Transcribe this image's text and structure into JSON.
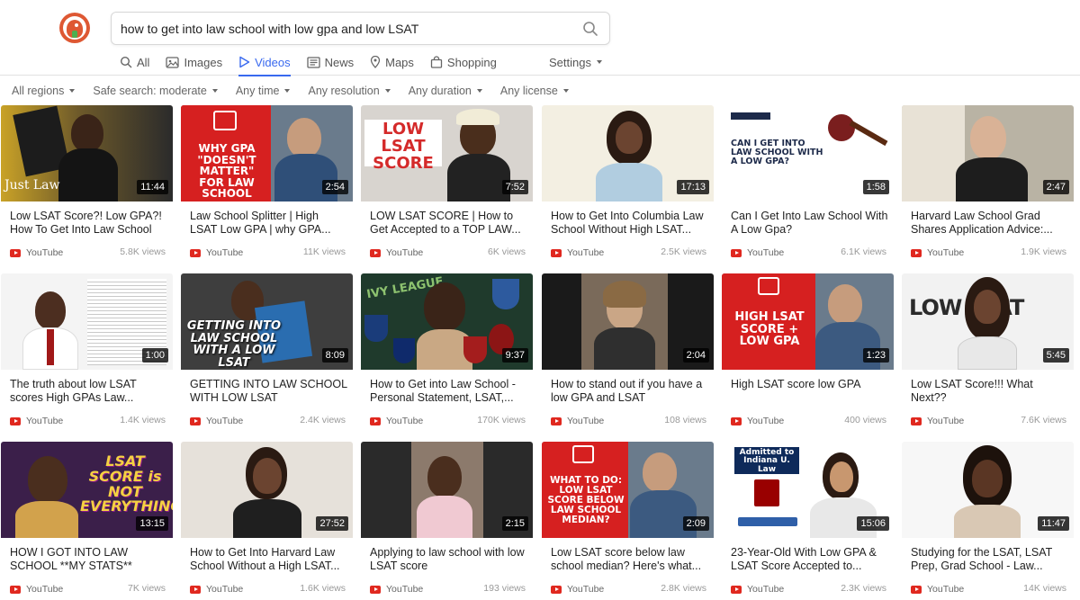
{
  "search": {
    "query": "how to get into law school with low gpa and low LSAT"
  },
  "tabs": [
    {
      "label": "All",
      "icon": "search-icon",
      "active": false
    },
    {
      "label": "Images",
      "icon": "image-icon",
      "active": false
    },
    {
      "label": "Videos",
      "icon": "play-icon",
      "active": true
    },
    {
      "label": "News",
      "icon": "news-icon",
      "active": false
    },
    {
      "label": "Maps",
      "icon": "map-pin-icon",
      "active": false
    },
    {
      "label": "Shopping",
      "icon": "shopping-bag-icon",
      "active": false
    }
  ],
  "settings_label": "Settings",
  "filters": [
    {
      "label": "All regions"
    },
    {
      "label": "Safe search: moderate"
    },
    {
      "label": "Any time"
    },
    {
      "label": "Any resolution"
    },
    {
      "label": "Any duration"
    },
    {
      "label": "Any license"
    }
  ],
  "source_label": "YouTube",
  "videos": [
    {
      "title": "Low LSAT Score?! Low GPA?! How To Get Into Law School",
      "duration": "11:44",
      "views": "5.8K views",
      "thumb_text": "Just Law"
    },
    {
      "title": "Law School Splitter | High LSAT Low GPA | why GPA...",
      "duration": "2:54",
      "views": "11K views",
      "thumb_text": "WHY GPA \"DOESN'T MATTER\" FOR LAW SCHOOL"
    },
    {
      "title": "LOW LSAT SCORE | How to Get Accepted to a TOP LAW...",
      "duration": "7:52",
      "views": "6K views",
      "thumb_text": "LOW LSAT SCORE"
    },
    {
      "title": "How to Get Into Columbia Law School Without High LSAT...",
      "duration": "17:13",
      "views": "2.5K views",
      "thumb_text": ""
    },
    {
      "title": "Can I Get Into Law School With A Low Gpa?",
      "duration": "1:58",
      "views": "6.1K views",
      "thumb_text": "CAN I GET INTO LAW SCHOOL WITH A LOW GPA?"
    },
    {
      "title": "Harvard Law School Grad Shares Application Advice:...",
      "duration": "2:47",
      "views": "1.9K views",
      "thumb_text": ""
    },
    {
      "title": "The truth about low LSAT scores High GPAs Law...",
      "duration": "1:00",
      "views": "1.4K views",
      "thumb_text": ""
    },
    {
      "title": "GETTING INTO LAW SCHOOL WITH LOW LSAT",
      "duration": "8:09",
      "views": "2.4K views",
      "thumb_text": "GETTING INTO LAW SCHOOL WITH A LOW LSAT"
    },
    {
      "title": "How to Get into Law School - Personal Statement, LSAT,...",
      "duration": "9:37",
      "views": "170K views",
      "thumb_text": "IVY LEAGUE"
    },
    {
      "title": "How to stand out if you have a low GPA and LSAT",
      "duration": "2:04",
      "views": "108 views",
      "thumb_text": ""
    },
    {
      "title": "High LSAT score low GPA",
      "duration": "1:23",
      "views": "400 views",
      "thumb_text": "HIGH LSAT SCORE + LOW GPA"
    },
    {
      "title": "Low LSAT Score!!! What Next??",
      "duration": "5:45",
      "views": "7.6K views",
      "thumb_text": "LOW LSAT"
    },
    {
      "title": "HOW I GOT INTO LAW SCHOOL **MY STATS**",
      "duration": "13:15",
      "views": "7K views",
      "thumb_text": "LSAT SCORE is NOT EVERYTHING"
    },
    {
      "title": "How to Get Into Harvard Law School Without a High LSAT...",
      "duration": "27:52",
      "views": "1.6K views",
      "thumb_text": ""
    },
    {
      "title": "Applying to law school with low LSAT score",
      "duration": "2:15",
      "views": "193 views",
      "thumb_text": ""
    },
    {
      "title": "Low LSAT score below law school median? Here's what...",
      "duration": "2:09",
      "views": "2.8K views",
      "thumb_text": "WHAT TO DO: LOW LSAT SCORE BELOW LAW SCHOOL MEDIAN?"
    },
    {
      "title": "23-Year-Old With Low GPA & LSAT Score Accepted to...",
      "duration": "15:06",
      "views": "2.3K views",
      "thumb_text": "Admitted to Indiana U. Law"
    },
    {
      "title": "Studying for the LSAT, LSAT Prep, Grad School - Law...",
      "duration": "11:47",
      "views": "14K views",
      "thumb_text": ""
    }
  ],
  "colors": {
    "accent": "#3969ef",
    "youtube_red": "#e0281f",
    "logo_orange": "#de5833"
  }
}
